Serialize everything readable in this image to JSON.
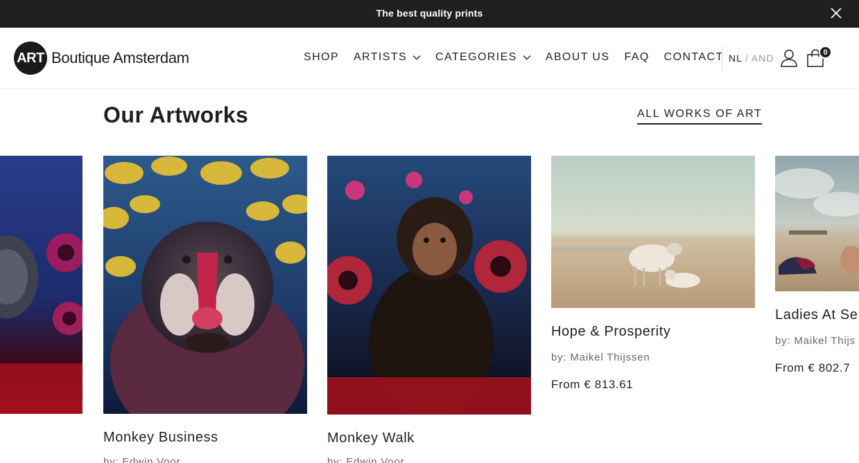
{
  "announcement": {
    "text": "The best quality prints"
  },
  "logo": {
    "badge": "ART",
    "name": "Boutique Amsterdam"
  },
  "nav": {
    "shop": "SHOP",
    "artists": "ARTISTS",
    "categories": "CATEGORIES",
    "about": "ABOUT US",
    "faq": "FAQ",
    "contact": "CONTACT"
  },
  "lang": {
    "nl": "NL",
    "sep": "/",
    "en": "AND"
  },
  "cart": {
    "count": "0"
  },
  "section": {
    "title": "Our Artworks",
    "all_link": "ALL WORKS OF ART"
  },
  "artworks": [
    {
      "title": "Monkey Business",
      "artist": "by: Edwin Voor",
      "price": ""
    },
    {
      "title": "Monkey Walk",
      "artist": "by: Edwin Voor",
      "price": ""
    },
    {
      "title": "Hope & Prosperity",
      "artist": "by: Maikel Thijssen",
      "price": "From  €  813.61"
    },
    {
      "title": "Ladies At Se",
      "artist": "by: Maikel Thijs",
      "price": "From  €  802.7"
    }
  ],
  "colors": {
    "topbar": "#1f1f1f",
    "text": "#1f1f1f",
    "muted": "#666666"
  }
}
